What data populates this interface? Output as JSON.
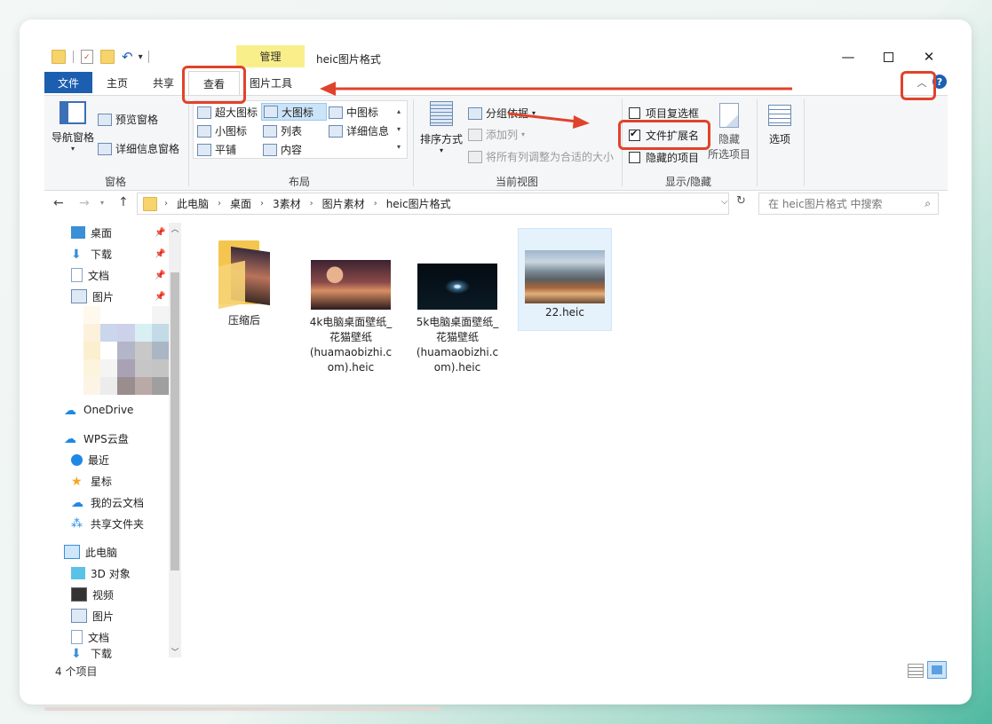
{
  "window": {
    "title": "heic图片格式",
    "contextual_tab": "管理"
  },
  "tabs": [
    {
      "label": "文件"
    },
    {
      "label": "主页"
    },
    {
      "label": "共享"
    },
    {
      "label": "查看"
    },
    {
      "label": "图片工具"
    }
  ],
  "ribbon": {
    "pane": {
      "nav_pane": "导航窗格",
      "preview_pane": "预览窗格",
      "details_pane": "详细信息窗格",
      "group": "窗格"
    },
    "layout": {
      "items": [
        "超大图标",
        "大图标",
        "中图标",
        "小图标",
        "列表",
        "详细信息",
        "平铺",
        "内容"
      ],
      "selected": "大图标",
      "group": "布局"
    },
    "current_view": {
      "sort_by": "排序方式",
      "group_by": "分组依据",
      "add_column": "添加列",
      "fit_columns": "将所有列调整为合适的大小",
      "group": "当前视图"
    },
    "show_hide": {
      "item_checkboxes": "项目复选框",
      "file_extensions": "文件扩展名",
      "hidden_items": "隐藏的项目",
      "hide_selected_line1": "隐藏",
      "hide_selected_line2": "所选项目",
      "item_checkboxes_checked": false,
      "file_extensions_checked": true,
      "hidden_items_checked": false,
      "group": "显示/隐藏"
    },
    "options": {
      "label": "选项"
    }
  },
  "address": {
    "breadcrumb": [
      "此电脑",
      "桌面",
      "3素材",
      "图片素材",
      "heic图片格式"
    ],
    "search_placeholder": "在 heic图片格式 中搜索"
  },
  "nav": {
    "quick": [
      "桌面",
      "下载",
      "文档",
      "图片"
    ],
    "onedrive": "OneDrive",
    "wps": "WPS云盘",
    "wps_items": [
      "最近",
      "星标",
      "我的云文档",
      "共享文件夹"
    ],
    "thispc": "此电脑",
    "pc_items": [
      "3D 对象",
      "视频",
      "图片",
      "文档",
      "下载"
    ]
  },
  "files": [
    {
      "name": "压缩后",
      "type": "folder"
    },
    {
      "name_lines": [
        "4k电脑桌面壁纸_",
        "花猫壁纸",
        "(huamaobizhi.c",
        "om).heic"
      ],
      "type": "image"
    },
    {
      "name_lines": [
        "5k电脑桌面壁纸_",
        "花猫壁纸",
        "(huamaobizhi.c",
        "om).heic"
      ],
      "type": "image"
    },
    {
      "name": "22.heic",
      "type": "image",
      "selected": true
    }
  ],
  "status": {
    "count": "4 个项目"
  },
  "colors": {
    "accent_blue": "#1c5fb0",
    "manage_tab": "#f9ef8a",
    "annotation_red": "#e0432c"
  }
}
